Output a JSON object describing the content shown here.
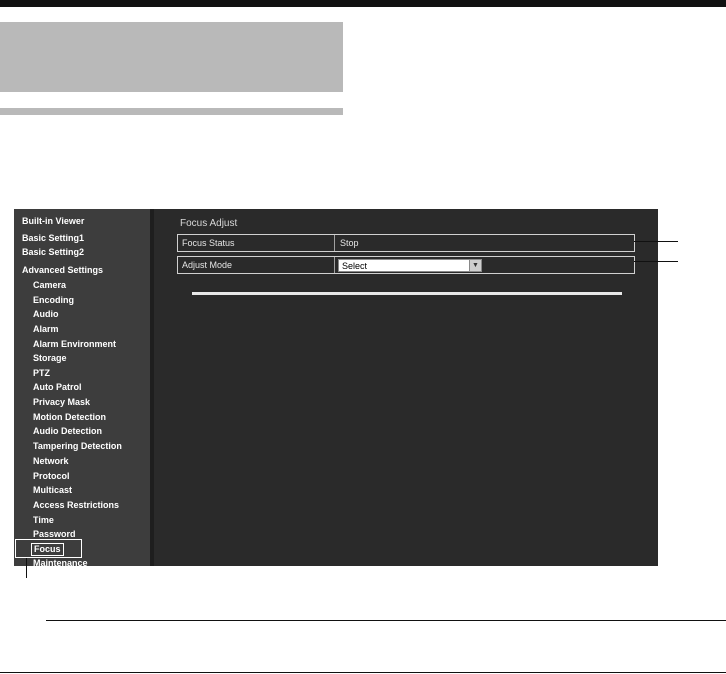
{
  "sidebar": {
    "items": [
      {
        "label": "Built-in Viewer"
      },
      {
        "label": "Basic Setting1"
      },
      {
        "label": "Basic Setting2"
      },
      {
        "label": "Advanced Settings"
      },
      {
        "label": "Camera"
      },
      {
        "label": "Encoding"
      },
      {
        "label": "Audio"
      },
      {
        "label": "Alarm"
      },
      {
        "label": "Alarm Environment"
      },
      {
        "label": "Storage"
      },
      {
        "label": "PTZ"
      },
      {
        "label": "Auto Patrol"
      },
      {
        "label": "Privacy Mask"
      },
      {
        "label": "Motion Detection"
      },
      {
        "label": "Audio Detection"
      },
      {
        "label": "Tampering Detection"
      },
      {
        "label": "Network"
      },
      {
        "label": "Protocol"
      },
      {
        "label": "Multicast"
      },
      {
        "label": "Access Restrictions"
      },
      {
        "label": "Time"
      },
      {
        "label": "Password"
      },
      {
        "label": "Focus"
      },
      {
        "label": "Maintenance"
      }
    ],
    "selected": "Focus"
  },
  "main": {
    "title": "Focus Adjust",
    "focus_status": {
      "label": "Focus Status",
      "value": "Stop"
    },
    "adjust_mode": {
      "label": "Adjust Mode",
      "value": "Select"
    }
  }
}
